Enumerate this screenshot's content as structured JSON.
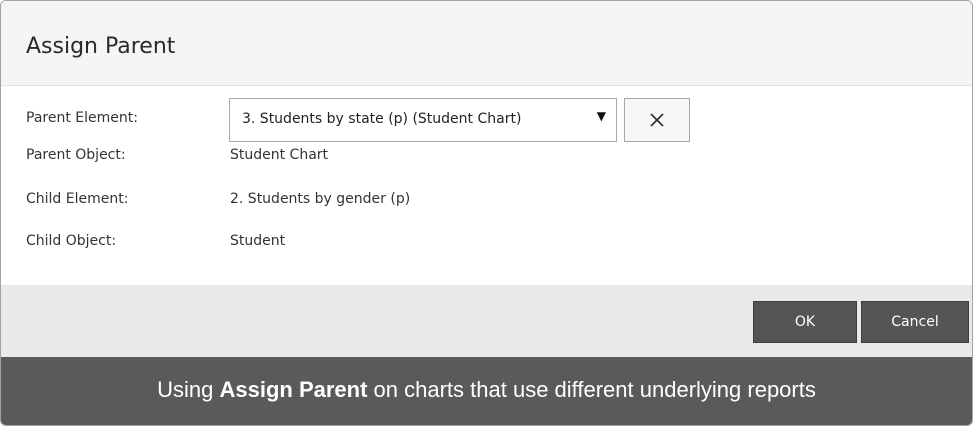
{
  "dialog": {
    "title": "Assign Parent",
    "fields": [
      {
        "label": "Parent Element:",
        "value": "3. Students by state (p) (Student Chart)"
      },
      {
        "label": "Parent Object:",
        "value": "Student Chart"
      },
      {
        "label": "Child Element:",
        "value": "2. Students by gender (p)"
      },
      {
        "label": "Child Object:",
        "value": "Student"
      }
    ],
    "select_arrow": "▼",
    "clear_icon": "close-icon",
    "buttons": {
      "ok": "OK",
      "cancel": "Cancel"
    }
  },
  "caption": {
    "prefix": "Using ",
    "bold": "Assign Parent",
    "suffix": " on charts that use different underlying reports"
  },
  "colors": {
    "header_bg": "#f5f5f5",
    "footer_bg": "#e9e9e9",
    "button_bg": "#555555",
    "caption_bg": "#5a5a5a"
  }
}
